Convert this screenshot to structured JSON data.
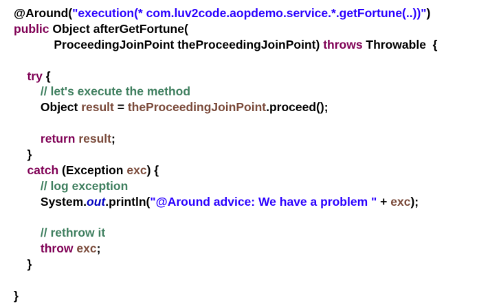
{
  "code": {
    "lines": [
      [
        [
          "plain",
          "@Around("
        ],
        [
          "str",
          "\"execution(* com.luv2code.aopdemo.service.*.getFortune(..))\""
        ],
        [
          "plain",
          ")"
        ]
      ],
      [
        [
          "kw",
          "public"
        ],
        [
          "plain",
          " Object afterGetFortune("
        ]
      ],
      [
        [
          "plain",
          "            ProceedingJoinPoint theProceedingJoinPoint) "
        ],
        [
          "kw",
          "throws"
        ],
        [
          "plain",
          " Throwable  {"
        ]
      ],
      [],
      [
        [
          "plain",
          "    "
        ],
        [
          "kw",
          "try"
        ],
        [
          "plain",
          " {"
        ]
      ],
      [
        [
          "plain",
          "        "
        ],
        [
          "cmt",
          "// let's execute the method"
        ]
      ],
      [
        [
          "plain",
          "        Object "
        ],
        [
          "var",
          "result"
        ],
        [
          "plain",
          " = "
        ],
        [
          "var",
          "theProceedingJoinPoint"
        ],
        [
          "plain",
          ".proceed();"
        ]
      ],
      [],
      [
        [
          "plain",
          "        "
        ],
        [
          "kw",
          "return"
        ],
        [
          "plain",
          " "
        ],
        [
          "var",
          "result"
        ],
        [
          "plain",
          ";"
        ]
      ],
      [
        [
          "plain",
          "    }"
        ]
      ],
      [
        [
          "plain",
          "    "
        ],
        [
          "kw",
          "catch"
        ],
        [
          "plain",
          " (Exception "
        ],
        [
          "var",
          "exc"
        ],
        [
          "plain",
          ") {"
        ]
      ],
      [
        [
          "plain",
          "        "
        ],
        [
          "cmt",
          "// log exception"
        ]
      ],
      [
        [
          "plain",
          "        System."
        ],
        [
          "static",
          "out"
        ],
        [
          "plain",
          ".println("
        ],
        [
          "str",
          "\"@Around advice: We have a problem \""
        ],
        [
          "plain",
          " + "
        ],
        [
          "var",
          "exc"
        ],
        [
          "plain",
          ");"
        ]
      ],
      [],
      [
        [
          "plain",
          "        "
        ],
        [
          "cmt",
          "// rethrow it"
        ]
      ],
      [
        [
          "plain",
          "        "
        ],
        [
          "kw",
          "throw"
        ],
        [
          "plain",
          " "
        ],
        [
          "var",
          "exc"
        ],
        [
          "plain",
          ";"
        ]
      ],
      [
        [
          "plain",
          "    }"
        ]
      ],
      [],
      [
        [
          "plain",
          "}"
        ]
      ]
    ],
    "token_colors": {
      "plain": "#000000",
      "str": "#2a00ff",
      "kw": "#7f0055",
      "var": "#7a4a3a",
      "cmt": "#3f7f5f",
      "static": "#0000c0"
    }
  }
}
